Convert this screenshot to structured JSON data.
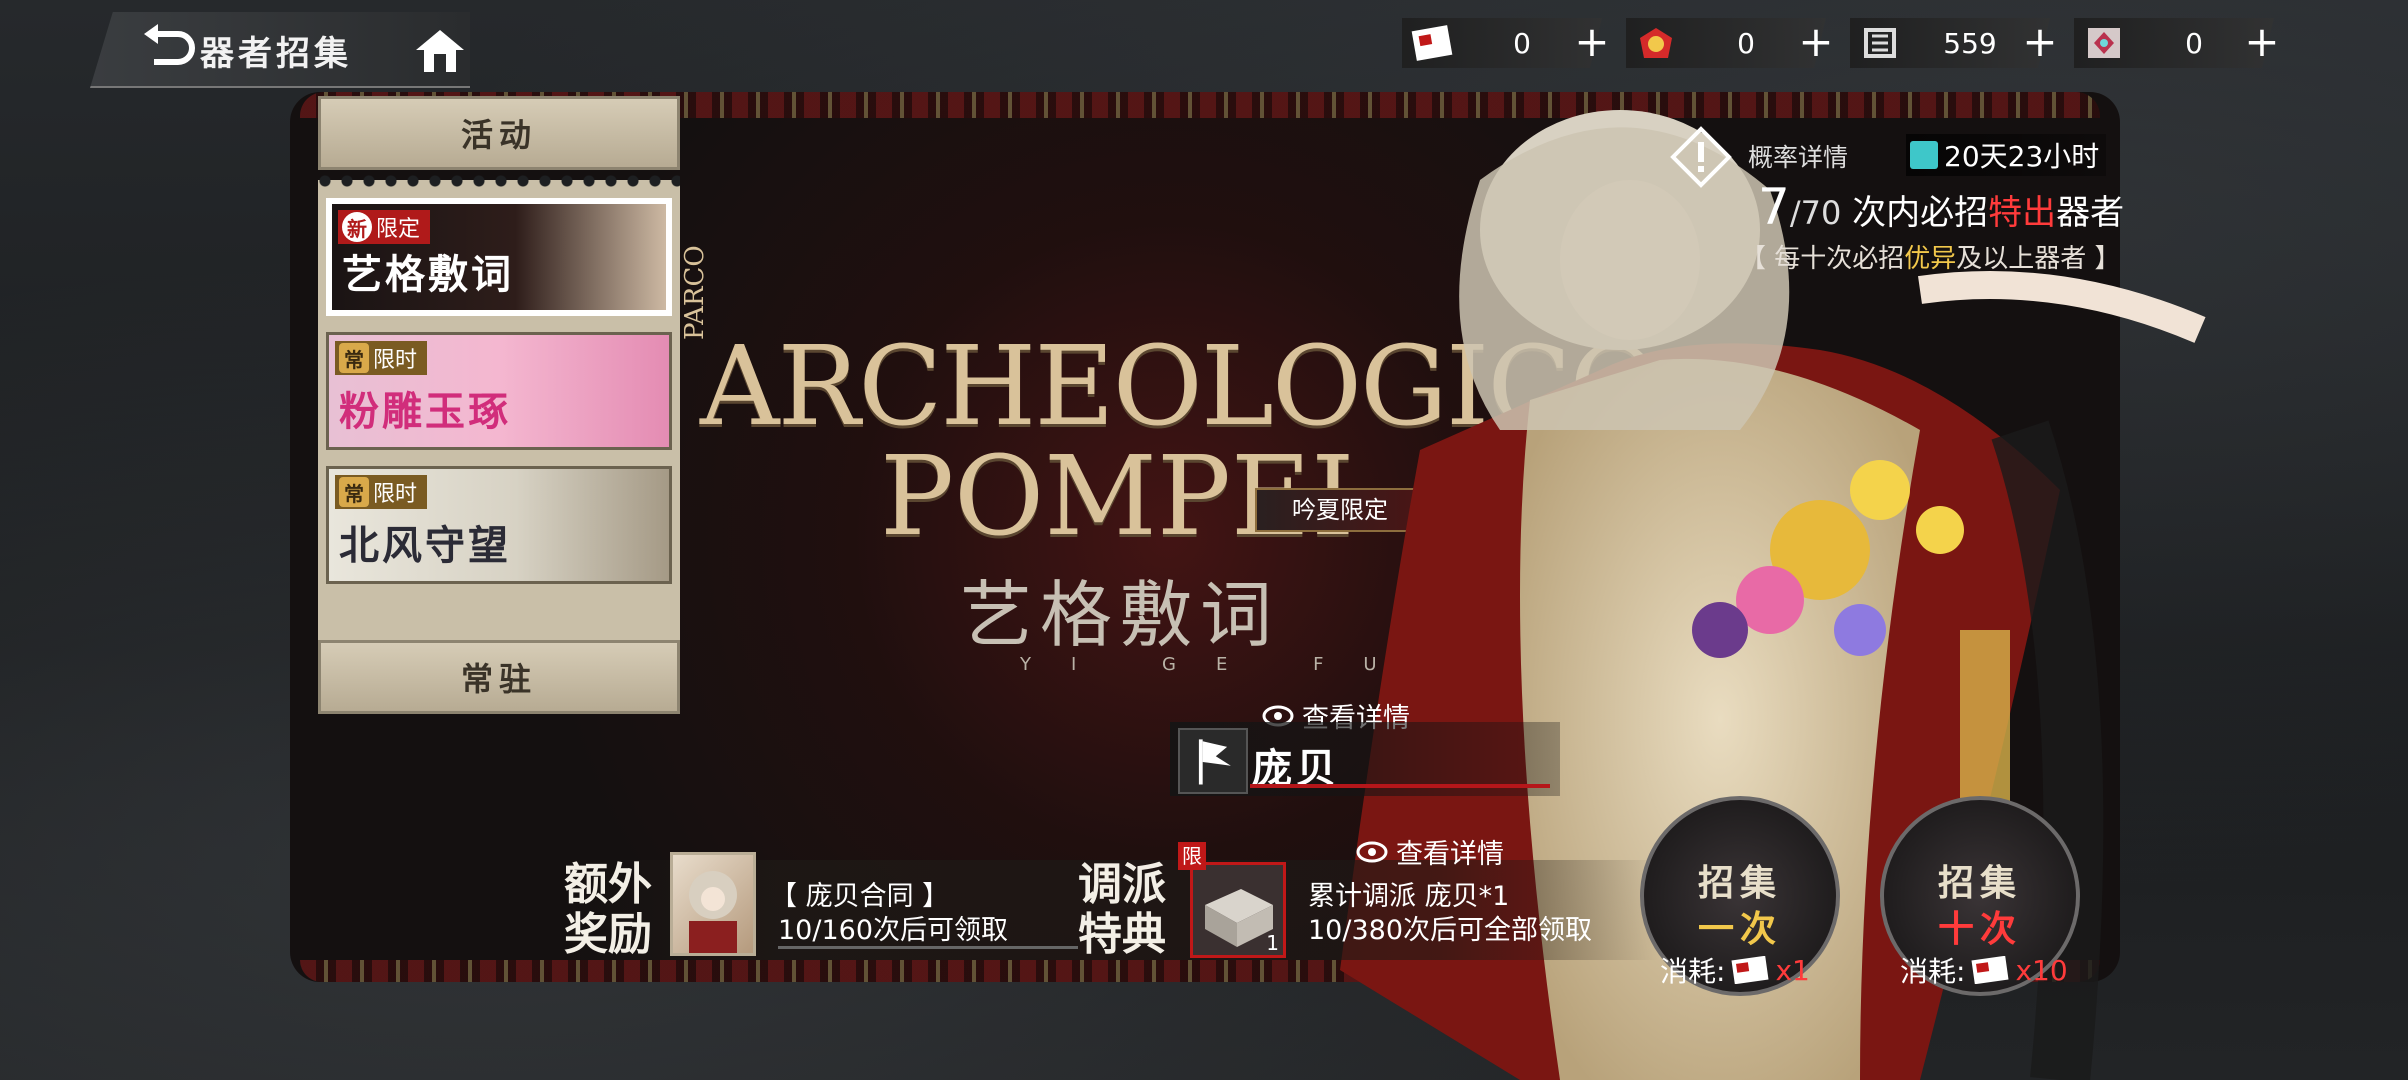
{
  "header": {
    "title": "器者招集",
    "back_icon": "back-arrow-icon",
    "home_icon": "home-icon"
  },
  "currencies": [
    {
      "icon": "red-envelope-ticket-icon",
      "value": "0",
      "plus": "+"
    },
    {
      "icon": "gold-token-icon",
      "value": "0",
      "plus": "+"
    },
    {
      "icon": "archive-token-icon",
      "value": "559",
      "plus": "+"
    },
    {
      "icon": "crystal-gem-icon",
      "value": "0",
      "plus": "+"
    }
  ],
  "sidebar": {
    "event_header": "活动",
    "permanent_header": "常驻",
    "items": [
      {
        "badge": "新",
        "tag": "限定",
        "name": "艺格敷词",
        "selected": true
      },
      {
        "badge": "常",
        "tag": "限时",
        "name": "粉雕玉琢",
        "selected": false
      },
      {
        "badge": "常",
        "tag": "限时",
        "name": "北风守望",
        "selected": false
      }
    ]
  },
  "logo": {
    "parco": "PARCO",
    "line1": "ARCHEOLOGICO",
    "line2": "POMPEI",
    "cn": "艺格敷词",
    "deco": "YI GE FU CI",
    "summer_tag": "吟夏限定"
  },
  "rate": {
    "label": "概率详情",
    "icon": "warning-diamond-icon"
  },
  "timer": {
    "text": "20天23小时"
  },
  "pity": {
    "current": "7",
    "total": "/70",
    "text_a": "次内必招",
    "text_b": "特出",
    "text_c": "器者",
    "sub_a": "【 每十次必招",
    "sub_b": "优异",
    "sub_c": "及以上器者 】"
  },
  "featured": {
    "view_detail": "查看详情",
    "name": "庞贝"
  },
  "extra_reward": {
    "title": "额外奖励",
    "item": "【 庞贝合同 】",
    "progress_current": "10",
    "progress_text": "/160次后可领取"
  },
  "dispatch_reward": {
    "title": "调派特典",
    "limited_badge": "限",
    "view_detail": "查看详情",
    "item": "累计调派 庞贝*1",
    "count": "1",
    "progress_current": "10",
    "progress_text": "/380次后可全部领取"
  },
  "summon": {
    "single": {
      "line1": "招集",
      "line2": "一次",
      "cost_label": "消耗:",
      "cost_value": "x1"
    },
    "ten": {
      "line1": "招集",
      "line2": "十次",
      "cost_label": "消耗:",
      "cost_value": "x10"
    }
  },
  "colors": {
    "accent_red": "#ff3b3b",
    "accent_gold": "#f2c84b",
    "timer_cyan": "#3ec7c9",
    "panel_beige": "#c9bfa8"
  }
}
